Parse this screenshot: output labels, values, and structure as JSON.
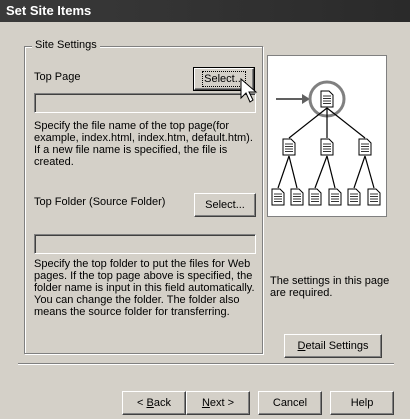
{
  "window": {
    "title": "Set Site Items"
  },
  "group": {
    "legend": "Site Settings"
  },
  "top_page": {
    "label": "Top Page",
    "select_label": "Select...",
    "value": "",
    "description": "Specify the file name of the top page(for example, index.html, index.htm, default.htm). If a new file name is specified, the file is created."
  },
  "top_folder": {
    "label": "Top Folder (Source Folder)",
    "select_label": "Select...",
    "value": "",
    "description": "Specify the top folder to put the files for Web pages. If the top page above is specified, the folder name is input in this field automatically. You can change the folder. The folder also means the source folder for transferring."
  },
  "info": {
    "required_text": "The settings in this page are required."
  },
  "detail_button": "Detail Settings",
  "footer": {
    "back": "< Back",
    "next": "Next >",
    "cancel": "Cancel",
    "help": "Help"
  },
  "icons": [
    "arrow-right-icon",
    "document-icon",
    "mouse-cursor-icon"
  ]
}
